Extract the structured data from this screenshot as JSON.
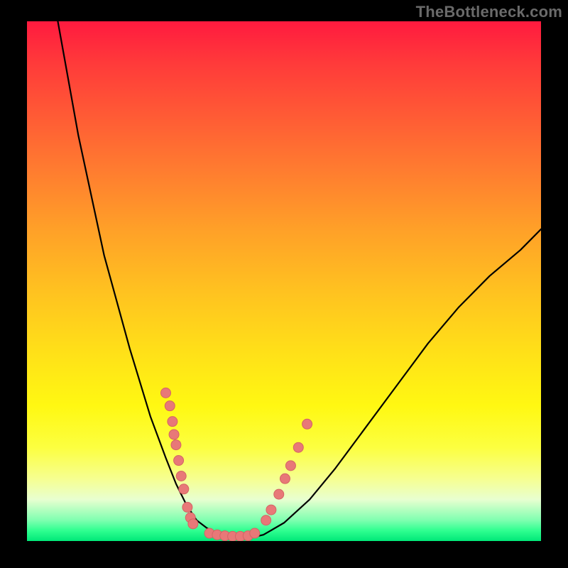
{
  "watermark": "TheBottleneck.com",
  "colors": {
    "background": "#000000",
    "curve": "#000000",
    "markers": "#e87878",
    "markers_stroke": "#d46464"
  },
  "chart_data": {
    "type": "line",
    "title": "",
    "xlabel": "",
    "ylabel": "",
    "xlim": [
      0,
      100
    ],
    "ylim": [
      0,
      100
    ],
    "grid": false,
    "series": [
      {
        "name": "curve",
        "x": [
          6,
          10,
          15,
          20,
          24,
          27,
          29,
          31,
          33,
          35,
          37,
          40,
          43,
          46,
          50,
          55,
          60,
          66,
          72,
          78,
          84,
          90,
          96,
          100
        ],
        "y": [
          100,
          78,
          55,
          37,
          24,
          16,
          11,
          7,
          4,
          2.5,
          1.5,
          0.8,
          0.5,
          1.2,
          3.5,
          8,
          14,
          22,
          30,
          38,
          45,
          51,
          56,
          60
        ]
      }
    ],
    "markers": {
      "left_cluster": [
        {
          "x": 27.0,
          "y": 28.5
        },
        {
          "x": 27.8,
          "y": 26.0
        },
        {
          "x": 28.3,
          "y": 23.0
        },
        {
          "x": 28.6,
          "y": 20.5
        },
        {
          "x": 29.0,
          "y": 18.5
        },
        {
          "x": 29.5,
          "y": 15.5
        },
        {
          "x": 30.0,
          "y": 12.5
        },
        {
          "x": 30.5,
          "y": 10.0
        },
        {
          "x": 31.2,
          "y": 6.5
        },
        {
          "x": 31.8,
          "y": 4.5
        },
        {
          "x": 32.3,
          "y": 3.3
        }
      ],
      "bottom_cluster": [
        {
          "x": 35.5,
          "y": 1.5
        },
        {
          "x": 37.0,
          "y": 1.2
        },
        {
          "x": 38.5,
          "y": 1.0
        },
        {
          "x": 40.0,
          "y": 0.9
        },
        {
          "x": 41.5,
          "y": 0.9
        },
        {
          "x": 43.0,
          "y": 1.0
        },
        {
          "x": 44.3,
          "y": 1.5
        }
      ],
      "right_cluster": [
        {
          "x": 46.5,
          "y": 4.0
        },
        {
          "x": 47.5,
          "y": 6.0
        },
        {
          "x": 49.0,
          "y": 9.0
        },
        {
          "x": 50.2,
          "y": 12.0
        },
        {
          "x": 51.3,
          "y": 14.5
        },
        {
          "x": 52.8,
          "y": 18.0
        },
        {
          "x": 54.5,
          "y": 22.5
        }
      ]
    }
  }
}
